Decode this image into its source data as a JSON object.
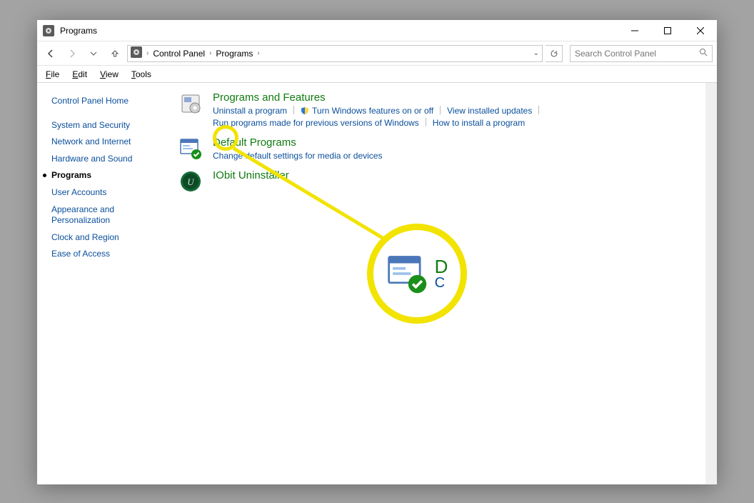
{
  "titlebar": {
    "title": "Programs"
  },
  "breadcrumb": {
    "root": "Control Panel",
    "current": "Programs"
  },
  "search": {
    "placeholder": "Search Control Panel"
  },
  "menus": {
    "file": "File",
    "edit": "Edit",
    "view": "View",
    "tools": "Tools"
  },
  "sidebar": {
    "items": [
      {
        "label": "Control Panel Home"
      },
      {
        "label": "System and Security"
      },
      {
        "label": "Network and Internet"
      },
      {
        "label": "Hardware and Sound"
      },
      {
        "label": "Programs",
        "active": true
      },
      {
        "label": "User Accounts"
      },
      {
        "label": "Appearance and Personalization"
      },
      {
        "label": "Clock and Region"
      },
      {
        "label": "Ease of Access"
      }
    ]
  },
  "categories": {
    "programs_features": {
      "title": "Programs and Features",
      "links": {
        "uninstall": "Uninstall a program",
        "windows_features": "Turn Windows features on or off",
        "installed_updates": "View installed updates",
        "compat": "Run programs made for previous versions of Windows",
        "how_install": "How to install a program"
      }
    },
    "default_programs": {
      "title": "Default Programs",
      "links": {
        "change_defaults": "Change default settings for media or devices"
      }
    },
    "iobit": {
      "title": "IObit Uninstaller"
    }
  },
  "annotation": {
    "zoom_title_fragment": "D",
    "zoom_sub_fragment": "C"
  }
}
